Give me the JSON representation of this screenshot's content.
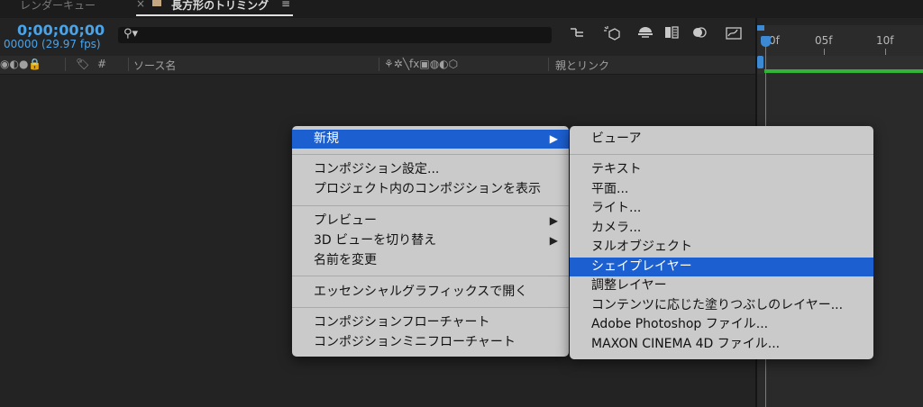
{
  "tabs": {
    "inactive_label": "レンダーキュー",
    "close_glyph": "×",
    "active_label": "長方形のトリミング",
    "menu_glyph": "≡"
  },
  "timecode": {
    "value": "0;00;00;00",
    "frames": "00000 (29.97 fps)"
  },
  "search": {
    "glyph": "⚲▾",
    "placeholder": ""
  },
  "columns": {
    "icons": "◉◐●🔒",
    "label_tag": "🏷",
    "number": "#",
    "source_name": "ソース名",
    "switches": "⚘✲╲fx▣◍◐⬡",
    "parent_link": "親とリンク"
  },
  "ruler": {
    "ticks": [
      "0f",
      "05f",
      "10f"
    ]
  },
  "menu1": {
    "items": [
      {
        "label": "新規",
        "arrow": "▶"
      },
      {
        "label": "コンポジション設定..."
      },
      {
        "label": "プロジェクト内のコンポジションを表示"
      },
      {
        "label": "プレビュー",
        "arrow": "▶"
      },
      {
        "label": "3D ビューを切り替え",
        "arrow": "▶"
      },
      {
        "label": "名前を変更"
      },
      {
        "label": "エッセンシャルグラフィックスで開く"
      },
      {
        "label": "コンポジションフローチャート"
      },
      {
        "label": "コンポジションミニフローチャート"
      }
    ]
  },
  "menu2": {
    "items": [
      {
        "label": "ビューア"
      },
      {
        "label": "テキスト"
      },
      {
        "label": "平面..."
      },
      {
        "label": "ライト..."
      },
      {
        "label": "カメラ..."
      },
      {
        "label": "ヌルオブジェクト"
      },
      {
        "label": "シェイプレイヤー"
      },
      {
        "label": "調整レイヤー"
      },
      {
        "label": "コンテンツに応じた塗りつぶしのレイヤー..."
      },
      {
        "label": "Adobe Photoshop ファイル..."
      },
      {
        "label": "MAXON CINEMA 4D ファイル..."
      }
    ]
  },
  "colors": {
    "accent": "#4ba3e8",
    "highlight": "#1c5fd0",
    "work_area": "#33b33a"
  }
}
